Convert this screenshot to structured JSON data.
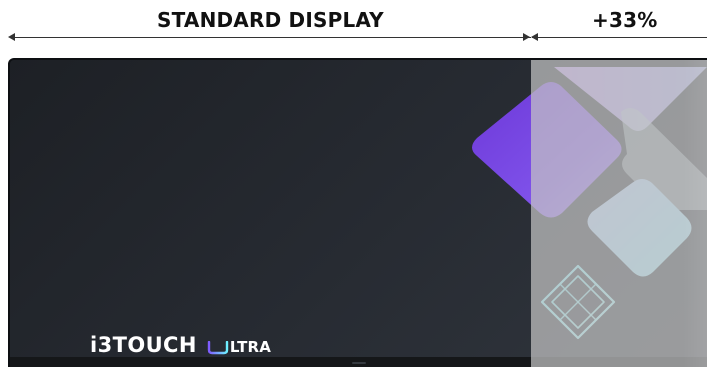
{
  "dimensions": {
    "standard_label": "STANDARD DISPLAY",
    "extra_label": "+33%"
  },
  "brand": {
    "name": "i3TOUCH",
    "ultra_text": "LTRA"
  },
  "icons": {
    "dimension_arrow": "arrow-icon",
    "brand_ultra_mark": "ultra-u-icon",
    "wireframe_diamond": "wireframe-diamond-icon"
  },
  "colors": {
    "screen_dark": "#262a31",
    "overlay_gray": "#c4c4c4",
    "violet": "#7c4ae8",
    "lavender": "#c8a8f6",
    "sky": "#9fdcf2",
    "line_cyan": "#90e2ef"
  }
}
